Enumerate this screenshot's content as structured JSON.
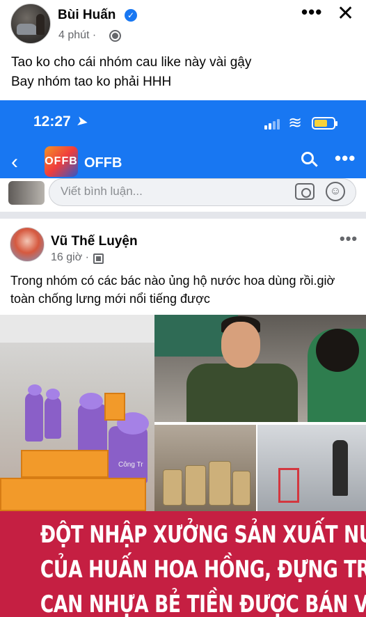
{
  "post": {
    "author": "Bùi Huấn",
    "time": "4 phút ·",
    "caption_line1": "Tao ko cho cái nhóm cau like này vài gậy",
    "caption_line2": "Bay nhóm tao ko phải HHH"
  },
  "embedded_screen": {
    "status_bar": {
      "time": "12:27"
    },
    "group_bar": {
      "logo_text": "OFFB",
      "group_name": "OFFB"
    },
    "comment_box": {
      "placeholder": "Viết bình luận..."
    },
    "inner_post": {
      "author": "Vũ Thế Luyện",
      "time": "16 giờ ·",
      "caption_line1": "Trong nhóm có các bác nào ủng hộ nước hoa dùng rồi.giờ",
      "caption_line2": "toàn chống lưng mới nổi tiếng được"
    },
    "news_image": {
      "headline_line1": "ĐỘT NHẬP XƯỞNG SẢN XUẤT NƯỚC HOA",
      "headline_line2": "CỦA HUẤN HOA HỒNG, ĐỰNG TRONG",
      "headline_line3": "CAN NHỰA BẺ TIỀN ĐƯỢC BÁN VỚI",
      "watermark": "Công Tr"
    }
  },
  "colors": {
    "facebook_blue": "#1877f2",
    "headline_red": "#c51f42",
    "secondary_text": "#65676b"
  },
  "icons": [
    "verified-badge-icon",
    "globe-icon",
    "more-icon",
    "close-icon",
    "location-arrow-icon",
    "signal-icon",
    "wifi-icon",
    "battery-icon",
    "back-icon",
    "search-icon",
    "camera-icon",
    "emoji-icon",
    "audience-icon"
  ]
}
